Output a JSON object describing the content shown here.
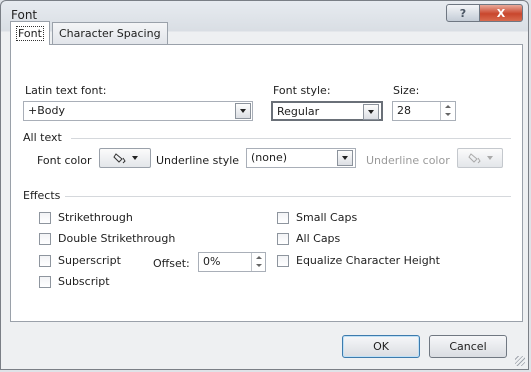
{
  "window": {
    "title": "Font",
    "help_glyph": "?",
    "close_glyph": "X"
  },
  "tabs": [
    {
      "label": "Font"
    },
    {
      "label": "Character Spacing"
    }
  ],
  "font": {
    "latin_label": "Latin text font:",
    "latin_value": "+Body",
    "style_label": "Font style:",
    "style_value": "Regular",
    "size_label": "Size:",
    "size_value": "28"
  },
  "all_text": {
    "section_label": "All text",
    "font_color_label": "Font color",
    "underline_style_label": "Underline style",
    "underline_style_value": "(none)",
    "underline_color_label": "Underline color"
  },
  "effects": {
    "section_label": "Effects",
    "strikethrough": "Strikethrough",
    "double_strikethrough": "Double Strikethrough",
    "superscript": "Superscript",
    "subscript": "Subscript",
    "offset_label": "Offset:",
    "offset_value": "0%",
    "small_caps": "Small Caps",
    "all_caps": "All Caps",
    "equalize": "Equalize Character Height"
  },
  "buttons": {
    "ok": "OK",
    "cancel": "Cancel"
  },
  "icons": {
    "paint_bucket": "paint-bucket-icon",
    "dropdown": "chevron-down-icon",
    "spinner": "spinner-icon"
  }
}
